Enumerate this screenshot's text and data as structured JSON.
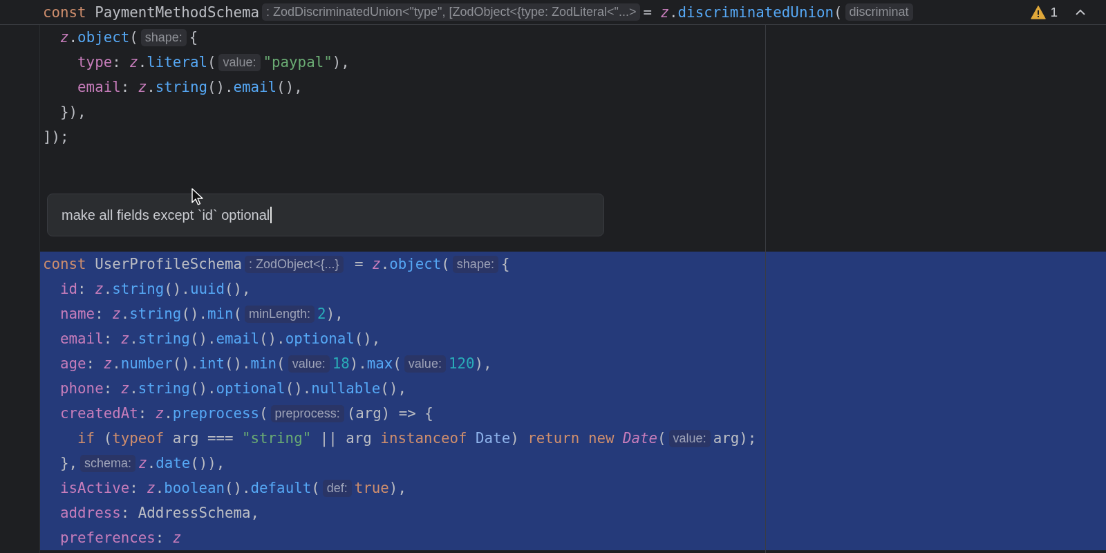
{
  "sticky_header": {
    "segments": [
      {
        "kind": "code",
        "tokens": [
          {
            "text": "const ",
            "kind": "keyword"
          },
          {
            "text": "PaymentMethodSchema",
            "kind": "plain"
          }
        ]
      },
      {
        "kind": "hint",
        "text": ": ZodDiscriminatedUnion<\"type\", [ZodObject<{type: ZodLiteral<\"...>"
      },
      {
        "kind": "code",
        "tokens": [
          {
            "text": "= ",
            "kind": "plain"
          },
          {
            "text": "z",
            "kind": "var"
          },
          {
            "text": ".",
            "kind": "plain"
          },
          {
            "text": "discriminatedUnion",
            "kind": "method"
          },
          {
            "text": "(",
            "kind": "plain"
          }
        ]
      },
      {
        "kind": "hint",
        "text": "discriminat"
      }
    ]
  },
  "problems": {
    "warnings": "1"
  },
  "lines": [
    {
      "selected": false,
      "segments": [
        {
          "kind": "code",
          "tokens": [
            {
              "text": "  z",
              "kind": "var"
            },
            {
              "text": ".",
              "kind": "plain"
            },
            {
              "text": "object",
              "kind": "method"
            },
            {
              "text": "(",
              "kind": "plain"
            }
          ]
        },
        {
          "kind": "hint",
          "text": "shape:"
        },
        {
          "kind": "code",
          "tokens": [
            {
              "text": "{",
              "kind": "plain"
            }
          ]
        }
      ]
    },
    {
      "selected": false,
      "segments": [
        {
          "kind": "code",
          "tokens": [
            {
              "text": "    type",
              "kind": "field"
            },
            {
              "text": ": ",
              "kind": "plain"
            },
            {
              "text": "z",
              "kind": "var"
            },
            {
              "text": ".",
              "kind": "plain"
            },
            {
              "text": "literal",
              "kind": "method"
            },
            {
              "text": "(",
              "kind": "plain"
            }
          ]
        },
        {
          "kind": "hint",
          "text": "value:"
        },
        {
          "kind": "code",
          "tokens": [
            {
              "text": "\"paypal\"",
              "kind": "string"
            },
            {
              "text": "),",
              "kind": "plain"
            }
          ]
        }
      ]
    },
    {
      "selected": false,
      "segments": [
        {
          "kind": "code",
          "tokens": [
            {
              "text": "    email",
              "kind": "field"
            },
            {
              "text": ": ",
              "kind": "plain"
            },
            {
              "text": "z",
              "kind": "var"
            },
            {
              "text": ".",
              "kind": "plain"
            },
            {
              "text": "string",
              "kind": "method"
            },
            {
              "text": "().",
              "kind": "plain"
            },
            {
              "text": "email",
              "kind": "method"
            },
            {
              "text": "(),",
              "kind": "plain"
            }
          ]
        }
      ]
    },
    {
      "selected": false,
      "segments": [
        {
          "kind": "code",
          "tokens": [
            {
              "text": "  }),",
              "kind": "plain"
            }
          ]
        }
      ]
    },
    {
      "selected": false,
      "segments": [
        {
          "kind": "code",
          "tokens": [
            {
              "text": "]);",
              "kind": "plain"
            }
          ]
        }
      ]
    }
  ],
  "prompt": {
    "value": "make all fields except `id` optional"
  },
  "selection_lines": [
    {
      "selected": true,
      "segments": [
        {
          "kind": "code",
          "tokens": [
            {
              "text": "const ",
              "kind": "keyword"
            },
            {
              "text": "UserProfileSchema",
              "kind": "plain"
            }
          ]
        },
        {
          "kind": "hint",
          "text": ": ZodObject<{...}"
        },
        {
          "kind": "code",
          "tokens": [
            {
              "text": " = ",
              "kind": "plain"
            },
            {
              "text": "z",
              "kind": "var"
            },
            {
              "text": ".",
              "kind": "plain"
            },
            {
              "text": "object",
              "kind": "method"
            },
            {
              "text": "(",
              "kind": "plain"
            }
          ]
        },
        {
          "kind": "hint",
          "text": "shape:"
        },
        {
          "kind": "code",
          "tokens": [
            {
              "text": "{",
              "kind": "plain"
            }
          ]
        }
      ]
    },
    {
      "selected": true,
      "segments": [
        {
          "kind": "code",
          "tokens": [
            {
              "text": "  id",
              "kind": "field"
            },
            {
              "text": ": ",
              "kind": "plain"
            },
            {
              "text": "z",
              "kind": "var"
            },
            {
              "text": ".",
              "kind": "plain"
            },
            {
              "text": "string",
              "kind": "method"
            },
            {
              "text": "().",
              "kind": "plain"
            },
            {
              "text": "uuid",
              "kind": "method"
            },
            {
              "text": "(),",
              "kind": "plain"
            }
          ]
        }
      ]
    },
    {
      "selected": true,
      "segments": [
        {
          "kind": "code",
          "tokens": [
            {
              "text": "  name",
              "kind": "field"
            },
            {
              "text": ": ",
              "kind": "plain"
            },
            {
              "text": "z",
              "kind": "var"
            },
            {
              "text": ".",
              "kind": "plain"
            },
            {
              "text": "string",
              "kind": "method"
            },
            {
              "text": "().",
              "kind": "plain"
            },
            {
              "text": "min",
              "kind": "method"
            },
            {
              "text": "(",
              "kind": "plain"
            }
          ]
        },
        {
          "kind": "hint",
          "text": "minLength:"
        },
        {
          "kind": "code",
          "tokens": [
            {
              "text": "2",
              "kind": "number"
            },
            {
              "text": "),",
              "kind": "plain"
            }
          ]
        }
      ]
    },
    {
      "selected": true,
      "segments": [
        {
          "kind": "code",
          "tokens": [
            {
              "text": "  email",
              "kind": "field"
            },
            {
              "text": ": ",
              "kind": "plain"
            },
            {
              "text": "z",
              "kind": "var"
            },
            {
              "text": ".",
              "kind": "plain"
            },
            {
              "text": "string",
              "kind": "method"
            },
            {
              "text": "().",
              "kind": "plain"
            },
            {
              "text": "email",
              "kind": "method"
            },
            {
              "text": "().",
              "kind": "plain"
            },
            {
              "text": "optional",
              "kind": "method"
            },
            {
              "text": "(),",
              "kind": "plain"
            }
          ]
        }
      ]
    },
    {
      "selected": true,
      "segments": [
        {
          "kind": "code",
          "tokens": [
            {
              "text": "  age",
              "kind": "field"
            },
            {
              "text": ": ",
              "kind": "plain"
            },
            {
              "text": "z",
              "kind": "var"
            },
            {
              "text": ".",
              "kind": "plain"
            },
            {
              "text": "number",
              "kind": "method"
            },
            {
              "text": "().",
              "kind": "plain"
            },
            {
              "text": "int",
              "kind": "method"
            },
            {
              "text": "().",
              "kind": "plain"
            },
            {
              "text": "min",
              "kind": "method"
            },
            {
              "text": "(",
              "kind": "plain"
            }
          ]
        },
        {
          "kind": "hint",
          "text": "value:"
        },
        {
          "kind": "code",
          "tokens": [
            {
              "text": "18",
              "kind": "number"
            },
            {
              "text": ").",
              "kind": "plain"
            },
            {
              "text": "max",
              "kind": "method"
            },
            {
              "text": "(",
              "kind": "plain"
            }
          ]
        },
        {
          "kind": "hint",
          "text": "value:"
        },
        {
          "kind": "code",
          "tokens": [
            {
              "text": "120",
              "kind": "number"
            },
            {
              "text": "),",
              "kind": "plain"
            }
          ]
        }
      ]
    },
    {
      "selected": true,
      "segments": [
        {
          "kind": "code",
          "tokens": [
            {
              "text": "  phone",
              "kind": "field"
            },
            {
              "text": ": ",
              "kind": "plain"
            },
            {
              "text": "z",
              "kind": "var"
            },
            {
              "text": ".",
              "kind": "plain"
            },
            {
              "text": "string",
              "kind": "method"
            },
            {
              "text": "().",
              "kind": "plain"
            },
            {
              "text": "optional",
              "kind": "method"
            },
            {
              "text": "().",
              "kind": "plain"
            },
            {
              "text": "nullable",
              "kind": "method"
            },
            {
              "text": "(),",
              "kind": "plain"
            }
          ]
        }
      ]
    },
    {
      "selected": true,
      "segments": [
        {
          "kind": "code",
          "tokens": [
            {
              "text": "  createdAt",
              "kind": "field"
            },
            {
              "text": ": ",
              "kind": "plain"
            },
            {
              "text": "z",
              "kind": "var"
            },
            {
              "text": ".",
              "kind": "plain"
            },
            {
              "text": "preprocess",
              "kind": "method"
            },
            {
              "text": "(",
              "kind": "plain"
            }
          ]
        },
        {
          "kind": "hint",
          "text": "preprocess:"
        },
        {
          "kind": "code",
          "tokens": [
            {
              "text": "(arg) => {",
              "kind": "plain"
            }
          ]
        }
      ]
    },
    {
      "selected": true,
      "segments": [
        {
          "kind": "code",
          "tokens": [
            {
              "text": "    if ",
              "kind": "keyword"
            },
            {
              "text": "(",
              "kind": "plain"
            },
            {
              "text": "typeof ",
              "kind": "keyword"
            },
            {
              "text": "arg === ",
              "kind": "plain"
            },
            {
              "text": "\"string\"",
              "kind": "string"
            },
            {
              "text": " || arg ",
              "kind": "plain"
            },
            {
              "text": "instanceof ",
              "kind": "keyword"
            },
            {
              "text": "Date",
              "kind": "class"
            },
            {
              "text": ") ",
              "kind": "plain"
            },
            {
              "text": "return new ",
              "kind": "keyword"
            },
            {
              "text": "Date",
              "kind": "ctor"
            },
            {
              "text": "(",
              "kind": "plain"
            }
          ]
        },
        {
          "kind": "hint",
          "text": "value:"
        },
        {
          "kind": "code",
          "tokens": [
            {
              "text": "arg);",
              "kind": "plain"
            }
          ]
        }
      ]
    },
    {
      "selected": true,
      "segments": [
        {
          "kind": "code",
          "tokens": [
            {
              "text": "  },",
              "kind": "plain"
            }
          ]
        },
        {
          "kind": "hint",
          "text": "schema:"
        },
        {
          "kind": "code",
          "tokens": [
            {
              "text": "z",
              "kind": "var"
            },
            {
              "text": ".",
              "kind": "plain"
            },
            {
              "text": "date",
              "kind": "method"
            },
            {
              "text": "()),",
              "kind": "plain"
            }
          ]
        }
      ]
    },
    {
      "selected": true,
      "segments": [
        {
          "kind": "code",
          "tokens": [
            {
              "text": "  isActive",
              "kind": "field"
            },
            {
              "text": ": ",
              "kind": "plain"
            },
            {
              "text": "z",
              "kind": "var"
            },
            {
              "text": ".",
              "kind": "plain"
            },
            {
              "text": "boolean",
              "kind": "method"
            },
            {
              "text": "().",
              "kind": "plain"
            },
            {
              "text": "default",
              "kind": "method"
            },
            {
              "text": "(",
              "kind": "plain"
            }
          ]
        },
        {
          "kind": "hint",
          "text": "def:"
        },
        {
          "kind": "code",
          "tokens": [
            {
              "text": "true",
              "kind": "keyword"
            },
            {
              "text": "),",
              "kind": "plain"
            }
          ]
        }
      ]
    },
    {
      "selected": true,
      "segments": [
        {
          "kind": "code",
          "tokens": [
            {
              "text": "  address",
              "kind": "field"
            },
            {
              "text": ": AddressSchema,",
              "kind": "plain"
            }
          ]
        }
      ]
    },
    {
      "selected": true,
      "segments": [
        {
          "kind": "code",
          "tokens": [
            {
              "text": "  preferences",
              "kind": "field"
            },
            {
              "text": ": ",
              "kind": "plain"
            },
            {
              "text": "z",
              "kind": "var"
            }
          ]
        }
      ]
    }
  ]
}
